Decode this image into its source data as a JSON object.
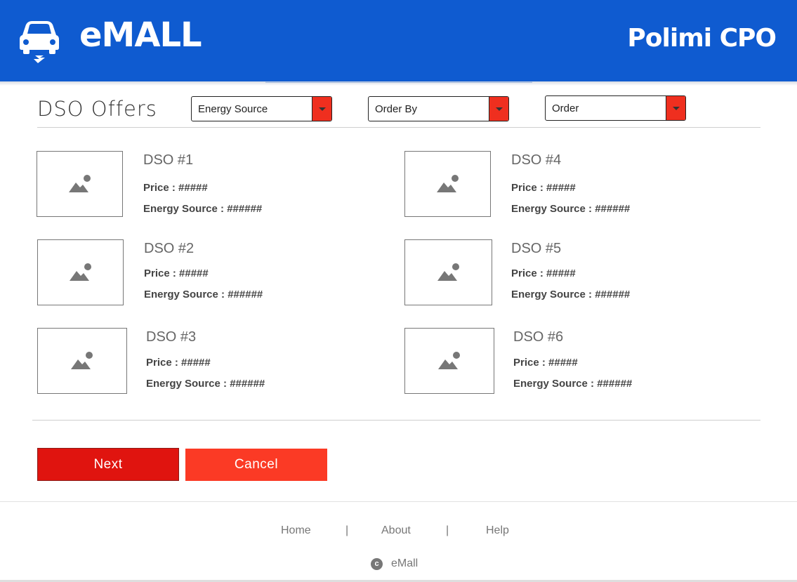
{
  "header": {
    "brand": "eMALL",
    "company": "Polimi CPO",
    "logo_icon": "car-charging-icon",
    "color": "#0f5bd0"
  },
  "toolbar": {
    "title": "DSO Offers",
    "filters": [
      {
        "label": "Energy Source"
      },
      {
        "label": "Order By"
      },
      {
        "label": "Order"
      }
    ],
    "accent": "#ef2f1f"
  },
  "offers": [
    {
      "name": "DSO #1",
      "price": "Price : #####",
      "source": "Energy Source : ######"
    },
    {
      "name": "DSO #2",
      "price": "Price : #####",
      "source": "Energy Source : ######"
    },
    {
      "name": "DSO #3",
      "price": "Price : #####",
      "source": "Energy Source : ######"
    },
    {
      "name": "DSO #4",
      "price": "Price : #####",
      "source": "Energy Source : ######"
    },
    {
      "name": "DSO #5",
      "price": "Price : #####",
      "source": "Energy Source : ######"
    },
    {
      "name": "DSO #6",
      "price": "Price : #####",
      "source": "Energy Source : ######"
    }
  ],
  "actions": {
    "next": "Next",
    "cancel": "Cancel",
    "next_color": "#e0140f",
    "cancel_color": "#fb3a25"
  },
  "footer": {
    "links": [
      "Home",
      "About",
      "Help"
    ],
    "separator": "|",
    "copyright_icon": "copyright-icon",
    "copyright_symbol": "c",
    "copyright_text": "eMall"
  }
}
